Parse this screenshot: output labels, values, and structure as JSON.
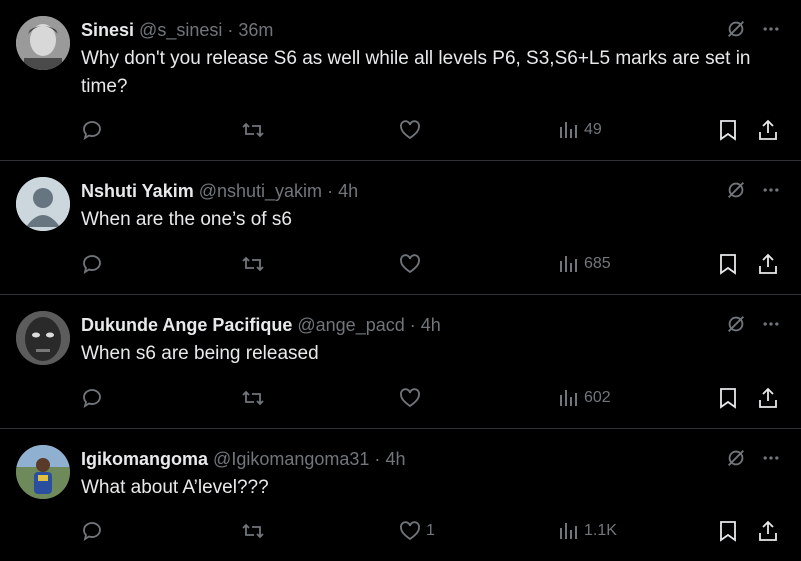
{
  "replies": [
    {
      "name": "Sinesi",
      "handle": "@s_sinesi",
      "separator": "·",
      "time": "36m",
      "text": "Why don't you release S6 as well while all levels P6, S3,S6+L5 marks are set in time?",
      "likes": "",
      "views": "49",
      "avatar_color": "#7a7a7a"
    },
    {
      "name": "Nshuti Yakim",
      "handle": "@nshuti_yakim",
      "separator": "·",
      "time": "4h",
      "text": "When are the one’s of s6",
      "likes": "",
      "views": "685",
      "avatar_color": "#ccd6dd"
    },
    {
      "name": "Dukunde Ange Pacifique",
      "handle": "@ange_pacd",
      "separator": "·",
      "time": "4h",
      "text": "When s6 are being released",
      "likes": "",
      "views": "602",
      "avatar_color": "#3a3a3a"
    },
    {
      "name": "Igikomangoma",
      "handle": "@Igikomangoma31",
      "separator": "·",
      "time": "4h",
      "text": "What about A’level???",
      "likes": "1",
      "views": "1.1K",
      "avatar_color": "#4a6b8a"
    }
  ],
  "colors": {
    "background": "#000000",
    "primary_text": "#e7e9ea",
    "secondary_text": "#71767b",
    "divider": "#2f3336"
  },
  "icons": [
    "grok-slash-icon",
    "more-icon",
    "reply-icon",
    "retweet-icon",
    "like-icon",
    "views-icon",
    "bookmark-icon",
    "share-icon"
  ]
}
